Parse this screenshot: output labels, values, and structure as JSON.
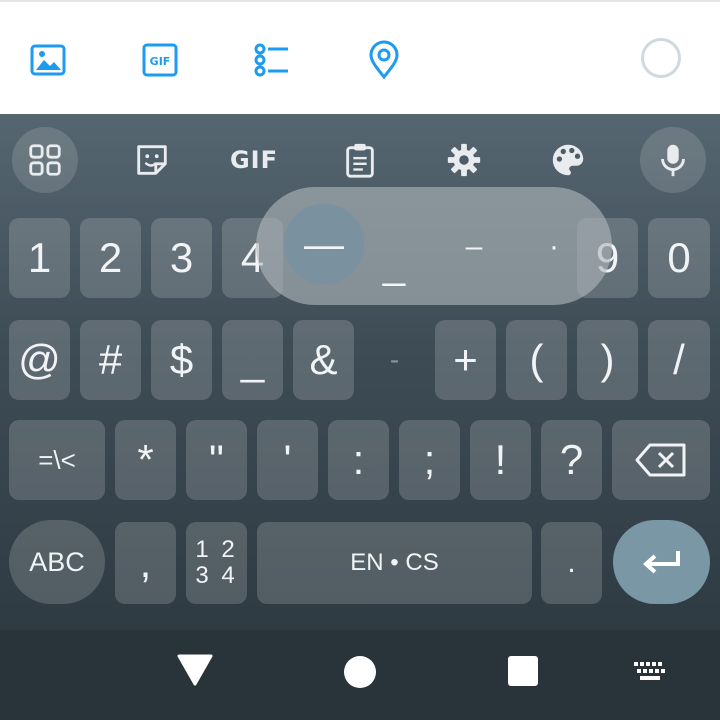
{
  "compose_toolbar": {
    "icons": [
      "image-icon",
      "gif-icon",
      "poll-icon",
      "location-pin-icon"
    ],
    "char_counter": "progress-ring"
  },
  "keyboard_toolbar": {
    "menu": "grid-icon",
    "sticker": "sticker-icon",
    "gif_label": "GIF",
    "clipboard": "clipboard-icon",
    "settings": "gear-icon",
    "theme": "palette-icon",
    "voice": "microphone-icon"
  },
  "popup": {
    "selected": "—",
    "chars": [
      "—",
      "_",
      "–",
      "·"
    ]
  },
  "rows": {
    "row1": [
      "1",
      "2",
      "3",
      "4",
      "9",
      "0"
    ],
    "row2": [
      "@",
      "#",
      "$",
      "_",
      "&",
      "-",
      "+",
      "(",
      ")",
      "/"
    ],
    "row3": [
      "=\\<",
      "*",
      "\"",
      "'",
      ":",
      ";",
      "!",
      "?"
    ],
    "row4": {
      "abc": "ABC",
      "comma": ",",
      "numpad_top": "1 2",
      "numpad_bottom": "3 4",
      "space": "EN • CS",
      "period": "."
    }
  },
  "colors": {
    "accent": "#1d9bf0",
    "enter": "#7a97a6",
    "key": "#6e7d87"
  },
  "navbar": {
    "back": "back-triangle-icon",
    "home": "home-circle-icon",
    "recents": "recents-square-icon",
    "keyboard": "keyboard-icon"
  }
}
